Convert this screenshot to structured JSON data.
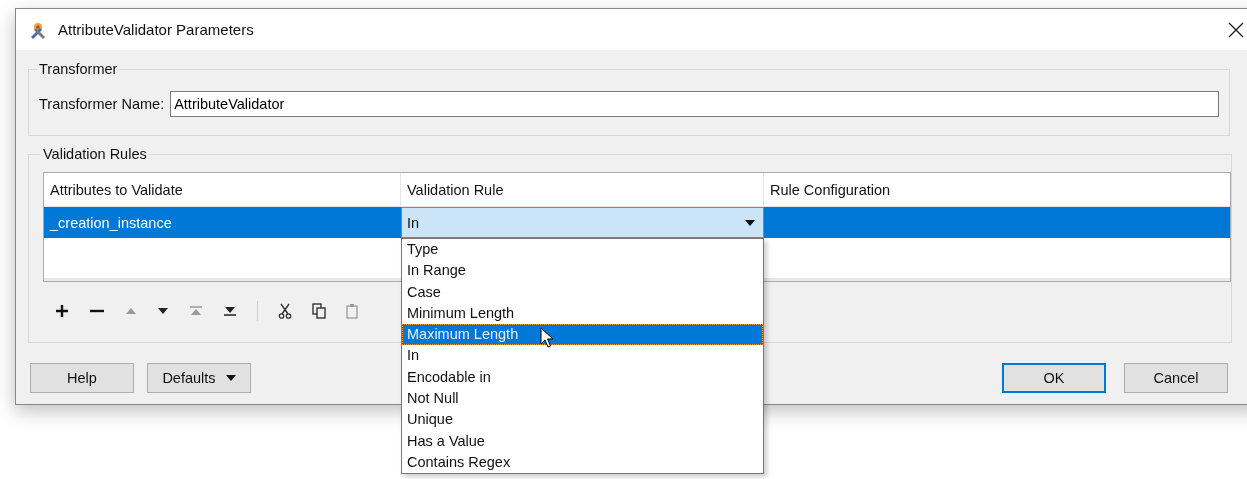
{
  "window": {
    "title": "AttributeValidator Parameters"
  },
  "transformer": {
    "group_title": "Transformer",
    "name_label": "Transformer Name:",
    "name_value": "AttributeValidator"
  },
  "validation_rules": {
    "group_title": "Validation Rules",
    "columns": [
      "Attributes to Validate",
      "Validation Rule",
      "Rule Configuration"
    ],
    "rows": [
      {
        "attribute": "_creation_instance",
        "rule": "In",
        "selected": true
      }
    ],
    "dropdown": {
      "expanded": true,
      "items": [
        {
          "label": "Type",
          "selected": false
        },
        {
          "label": "In Range",
          "selected": false
        },
        {
          "label": "Case",
          "selected": false
        },
        {
          "label": "Minimum Length",
          "selected": false
        },
        {
          "label": "Maximum Length",
          "selected": true
        },
        {
          "label": "In",
          "selected": false
        },
        {
          "label": "Encodable in",
          "selected": false
        },
        {
          "label": "Not Null",
          "selected": false
        },
        {
          "label": "Unique",
          "selected": false
        },
        {
          "label": "Has a Value",
          "selected": false
        },
        {
          "label": "Contains Regex",
          "selected": false
        }
      ]
    }
  },
  "buttons": [
    {
      "label": "Help",
      "kind": "plain"
    },
    {
      "label": "Defaults",
      "kind": "menu"
    },
    {
      "label": "OK",
      "kind": "default"
    },
    {
      "label": "Cancel",
      "kind": "plain"
    }
  ]
}
